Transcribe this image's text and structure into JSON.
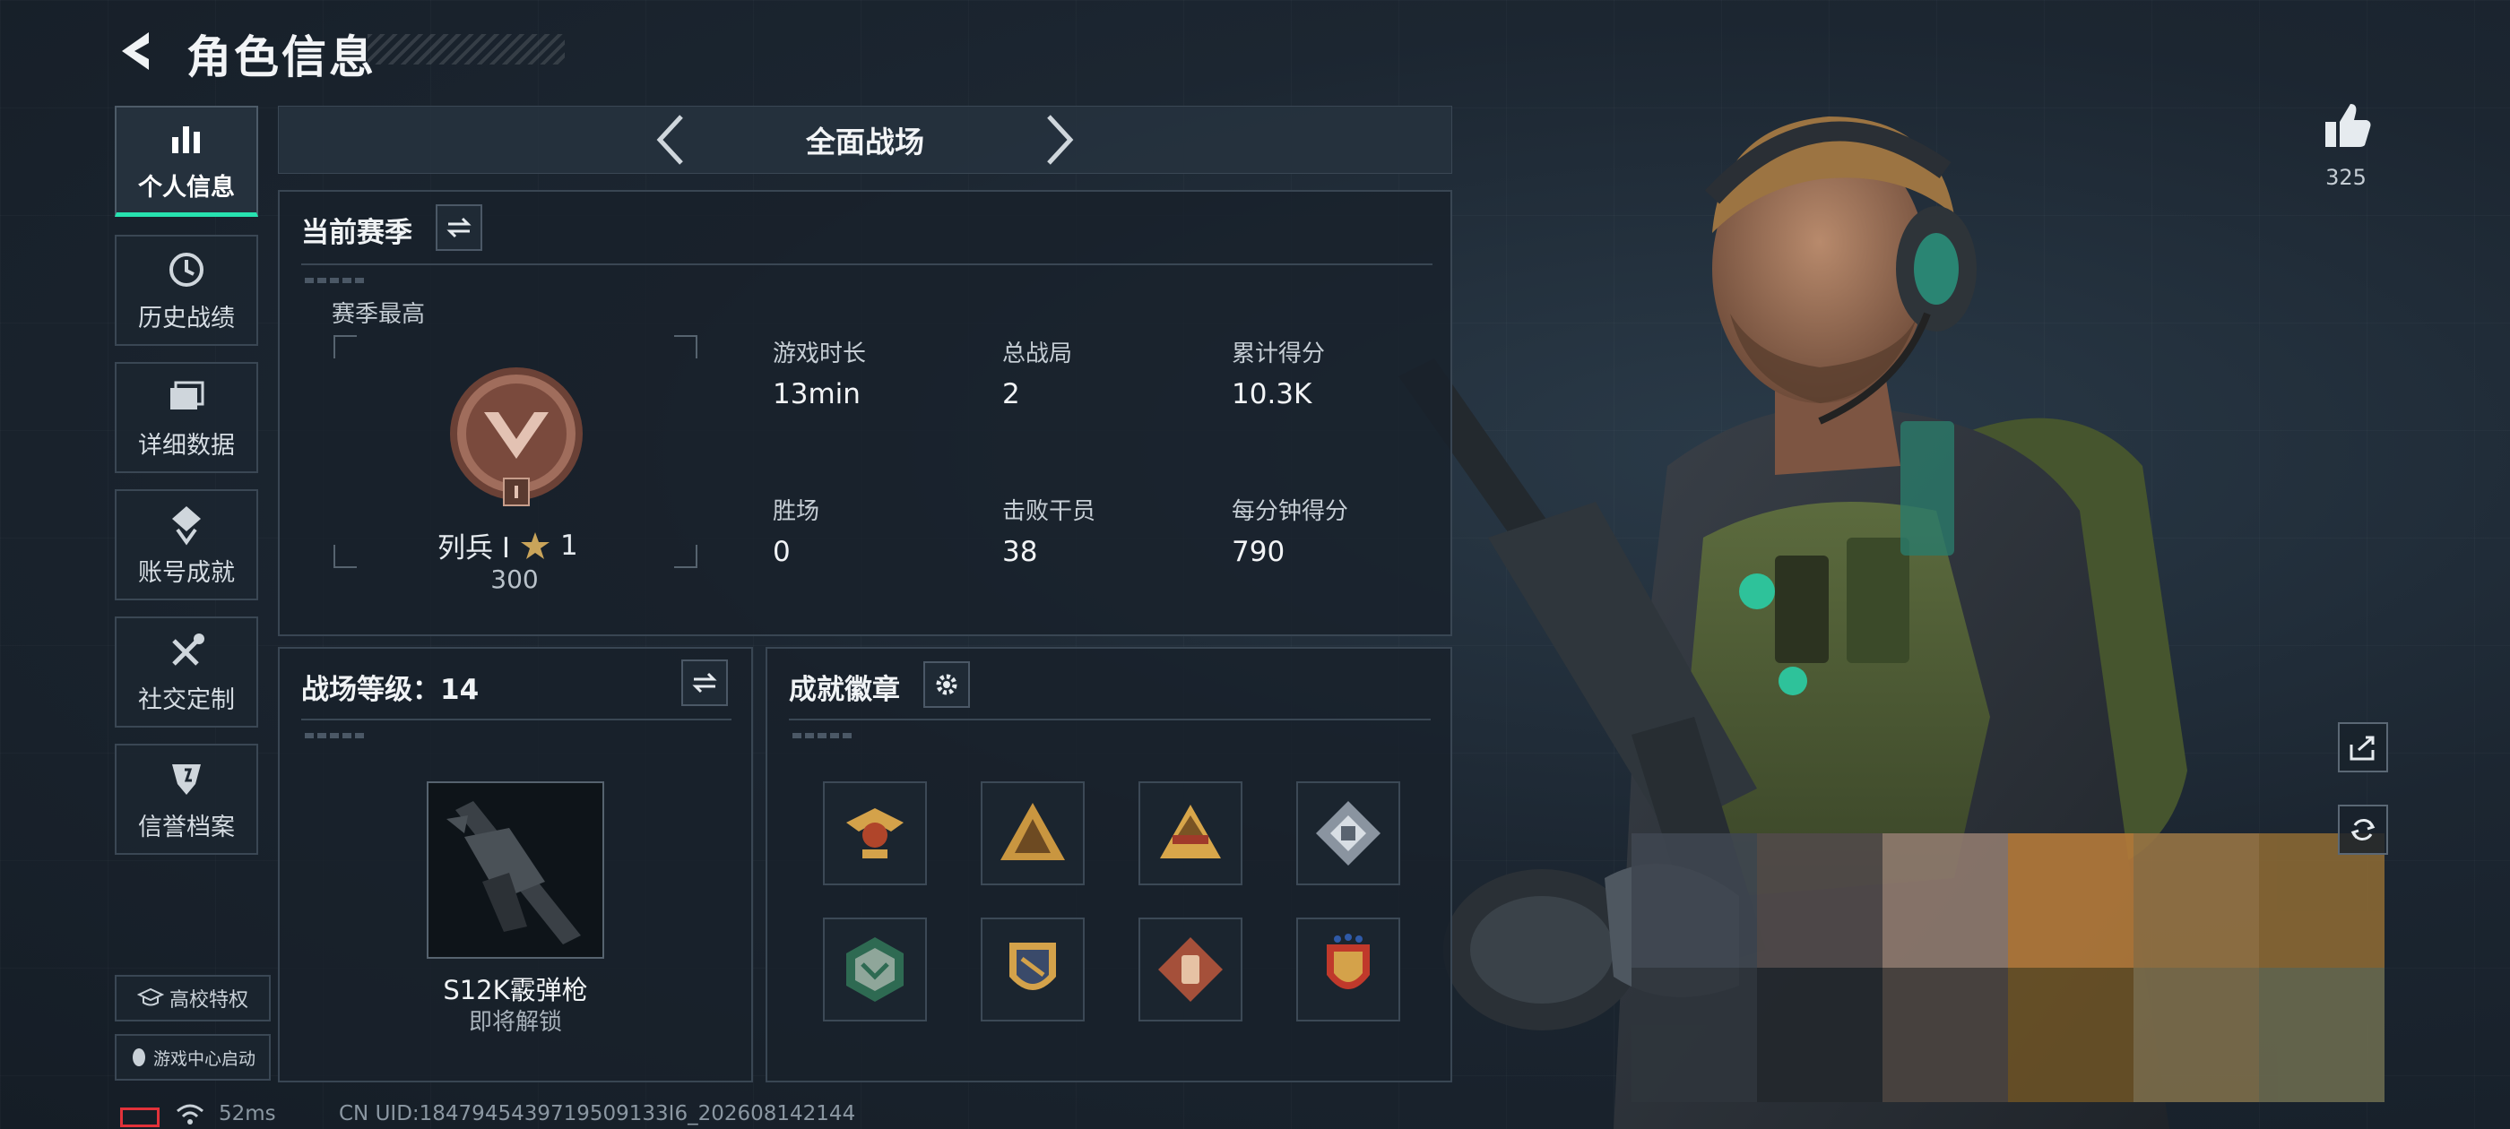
{
  "header": {
    "title": "角色信息",
    "back_icon": "back-arrow-icon"
  },
  "nav": [
    {
      "label": "个人信息",
      "icon": "bar-chart-icon",
      "active": true
    },
    {
      "label": "历史战绩",
      "icon": "history-clock-icon",
      "active": false
    },
    {
      "label": "详细数据",
      "icon": "folder-icon",
      "active": false
    },
    {
      "label": "账号成就",
      "icon": "achievement-icon",
      "active": false
    },
    {
      "label": "社交定制",
      "icon": "tools-icon",
      "active": false
    },
    {
      "label": "信誉档案",
      "icon": "shield-icon",
      "active": false
    }
  ],
  "side_buttons": {
    "campus": "高校特权",
    "game_center": "游戏中心启动"
  },
  "mode": {
    "title": "全面战场"
  },
  "season": {
    "title": "当前赛季",
    "best_label": "赛季最高",
    "rank_name": "列兵 I",
    "stars": "1",
    "rank_points": "300",
    "stats": [
      {
        "label": "游戏时长",
        "value": "13min"
      },
      {
        "label": "总战局",
        "value": "2"
      },
      {
        "label": "累计得分",
        "value": "10.3K"
      },
      {
        "label": "胜场",
        "value": "0"
      },
      {
        "label": "击败干员",
        "value": "38"
      },
      {
        "label": "每分钟得分",
        "value": "790"
      }
    ]
  },
  "battlefield": {
    "title": "战场等级：14",
    "weapon_name": "S12K霰弹枪",
    "weapon_status": "即将解锁"
  },
  "badges": {
    "title": "成就徽章",
    "items": [
      "eagle-badge-icon",
      "triangle-badge-icon",
      "pyramid-badge-icon",
      "cube-badge-icon",
      "hexagon-badge-icon",
      "crest-badge-icon",
      "diamond-badge-icon",
      "shield-star-badge-icon"
    ]
  },
  "likes": {
    "count": "325"
  },
  "footer": {
    "ping": "52ms",
    "uid": "CN UID:1847945439719509133I6_202608142144"
  },
  "colors": {
    "accent": "#27e2b0",
    "badge_gold": "#d4a24a",
    "ping_red": "#e2323a"
  }
}
